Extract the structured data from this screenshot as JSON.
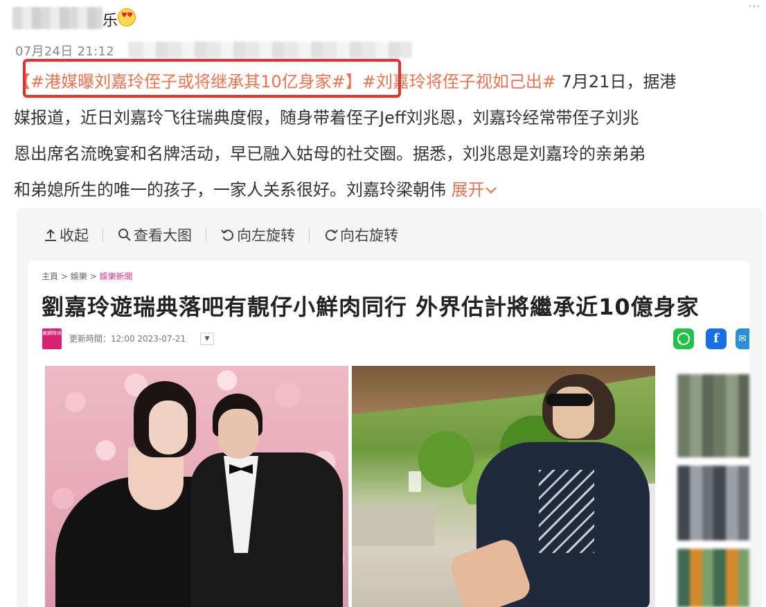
{
  "post": {
    "author_suffix": "乐",
    "timestamp": "07月24日 21:12",
    "highlighted_tag": "【#港媒曝刘嘉玲侄子或将继承其10亿身家#】",
    "tag2": "#刘嘉玲将侄子视如己出#",
    "line1_text": " 7月21日，据港",
    "line2": "媒报道，近日刘嘉玲飞往瑞典度假，随身带着侄子Jeff刘兆恩，刘嘉玲经常带侄子刘兆",
    "line3": "恩出席名流晚宴和名牌活动，早已融入姑母的社交圈。据悉，刘兆恩是刘嘉玲的亲弟弟",
    "line4": "和弟媳所生的唯一的孩子，一家人关系很好。刘嘉玲梁朝伟 ",
    "expand_label": "展开",
    "expand_icon": "chevron-down-icon"
  },
  "toolbar": {
    "collapse": "收起",
    "view_large": "查看大图",
    "rotate_left": "向左旋转",
    "rotate_right": "向右旋转"
  },
  "article": {
    "breadcrumb_home": "主頁",
    "breadcrumb_sep": ">",
    "breadcrumb_1": "娛樂",
    "breadcrumb_2": "娛樂新聞",
    "title": "劉嘉玲遊瑞典落吧有靚仔小鮮肉同行 外界估計將繼承近10億身家",
    "source_logo": "東網時尚",
    "source_meta": "更新時間：12:00 2023-07-21",
    "share_icons": [
      "whatsapp-icon",
      "facebook-icon",
      "mail-icon"
    ]
  },
  "colors": {
    "tag": "#eb7350",
    "highlight_border": "#e8312b",
    "breadcrumb_accent": "#e3388a"
  }
}
